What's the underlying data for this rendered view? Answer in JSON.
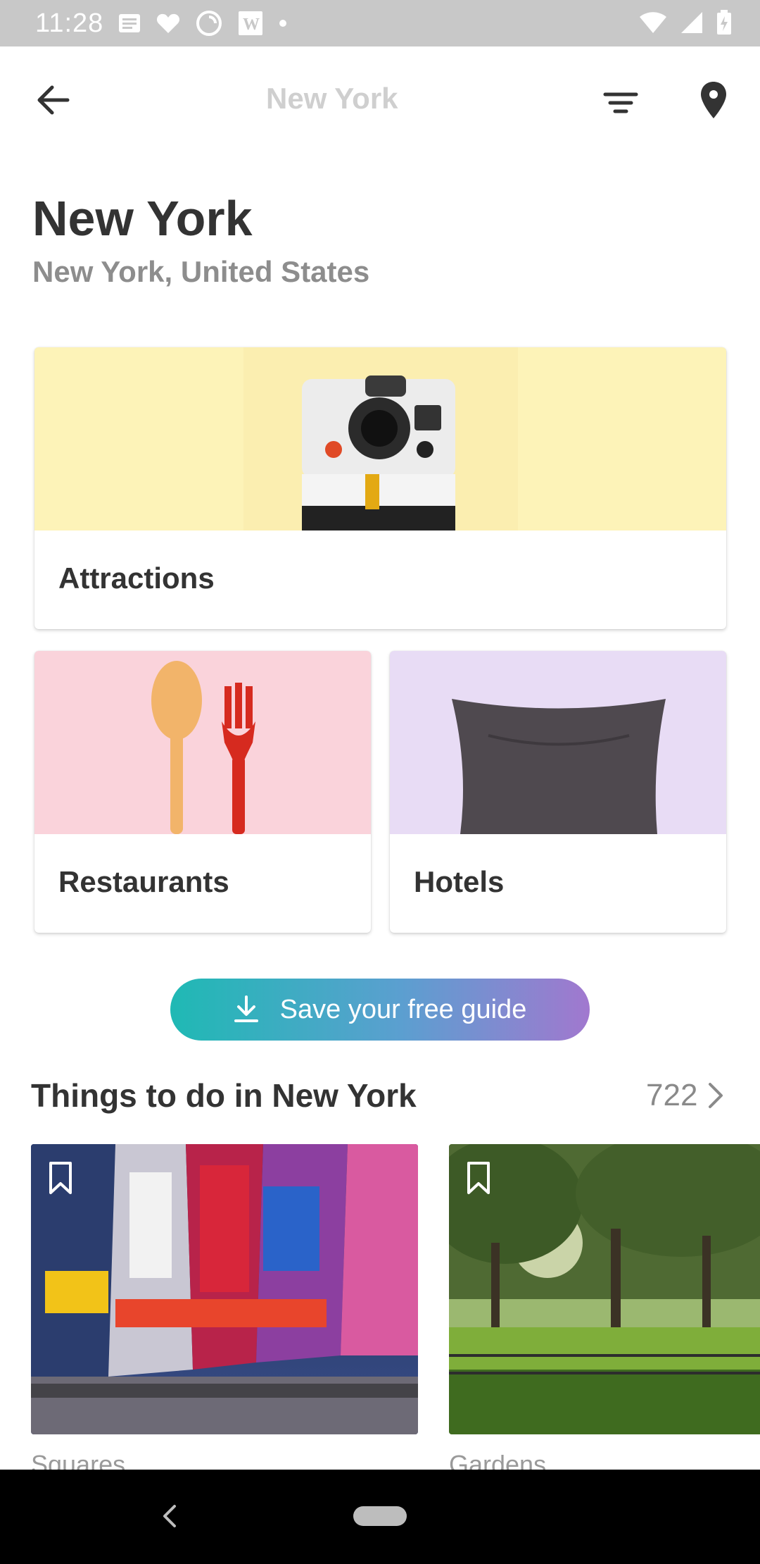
{
  "status_bar": {
    "time": "11:28",
    "icons_left": [
      "news-icon",
      "heart-icon",
      "sync-icon",
      "word-icon",
      "dot-icon"
    ],
    "icons_right": [
      "wifi-icon",
      "signal-icon",
      "battery-icon"
    ]
  },
  "app_bar": {
    "title": "New York",
    "back_icon": "arrow-left-icon",
    "filter_icon": "filter-icon",
    "map_icon": "map-pin-icon"
  },
  "header": {
    "city": "New York",
    "location": "New York, United States"
  },
  "categories": [
    {
      "label": "Attractions",
      "color": "#fdf3b8",
      "icon": "polaroid-camera-image"
    },
    {
      "label": "Restaurants",
      "color": "#fad3db",
      "icon": "spoon-fork-image"
    },
    {
      "label": "Hotels",
      "color": "#e8dcf5",
      "icon": "pillow-image"
    }
  ],
  "save_guide": {
    "label": "Save your free guide",
    "icon": "download-icon"
  },
  "things_to_do": {
    "title": "Things to do in New York",
    "count": "722",
    "items": [
      {
        "caption": "Squares",
        "image": "times-square-photo"
      },
      {
        "caption": "Gardens",
        "image": "central-park-photo"
      }
    ]
  },
  "colors": {
    "accent_start": "#1fb9b4",
    "accent_end": "#a178cf",
    "text_primary": "#333333",
    "text_secondary": "#8d8d8d"
  }
}
